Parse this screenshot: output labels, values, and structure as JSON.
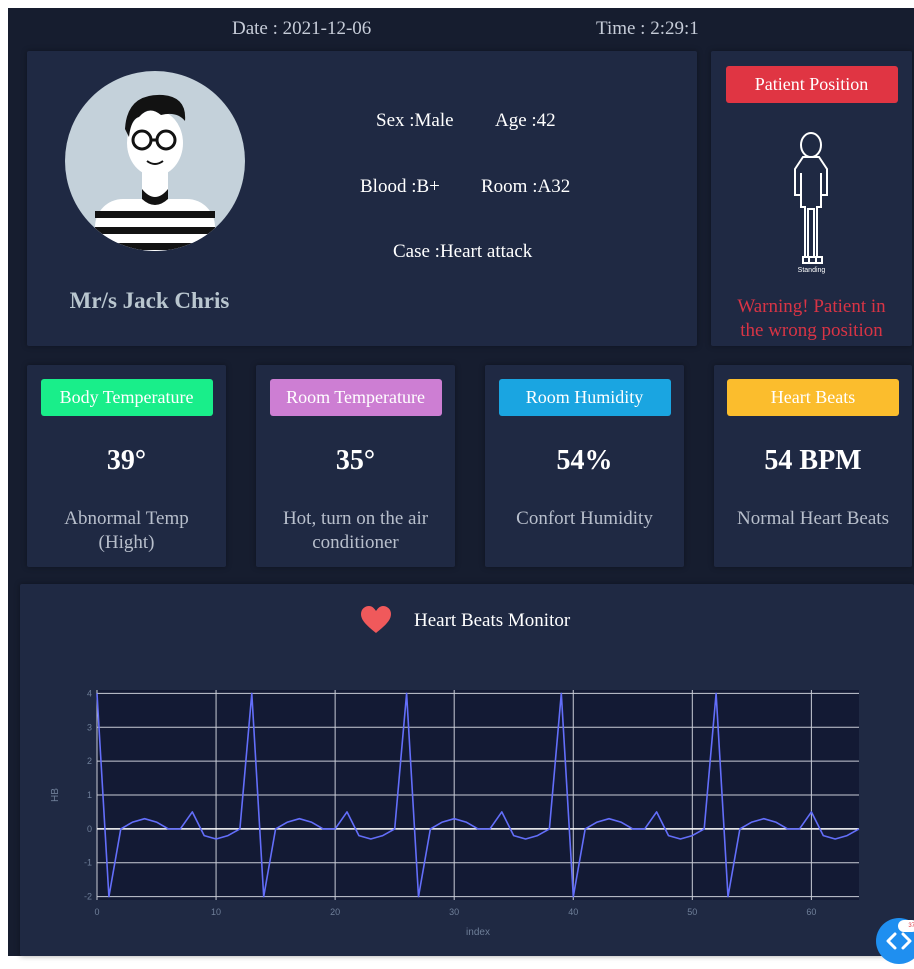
{
  "header": {
    "date": "Date : 2021-12-06",
    "time": "Time : 2:29:1"
  },
  "patient": {
    "name": "Mr/s Jack Chris",
    "sex": "Sex :Male",
    "age": "Age :42",
    "blood": "Blood :B+",
    "room": "Room :A32",
    "case": "Case :Heart attack"
  },
  "position": {
    "badge": "Patient Position",
    "figure_label": "Standing",
    "warning_line1": "Warning! Patient in",
    "warning_line2": "the wrong position",
    "badge_color": "#e03543"
  },
  "metrics": [
    {
      "badge": "Body Temperature",
      "value": "39°",
      "desc_line1": "Abnormal Temp",
      "desc_line2": "(Hight)",
      "color": "#19ee8a"
    },
    {
      "badge": "Room Temperature",
      "value": "35°",
      "desc_line1": "Hot, turn on the air",
      "desc_line2": "conditioner",
      "color": "#cd7ed3"
    },
    {
      "badge": "Room Humidity",
      "value": "54%",
      "desc_line1": "Confort Humidity",
      "desc_line2": "",
      "color": "#1aa5e1"
    },
    {
      "badge": "Heart Beats",
      "value": "54 BPM",
      "desc_line1": "Normal Heart Beats",
      "desc_line2": "",
      "color": "#fbbd2d"
    }
  ],
  "monitor": {
    "title": "Heart Beats Monitor",
    "icon": "heart-icon"
  },
  "chart_data": {
    "type": "line",
    "xlabel": "index",
    "ylabel": "HB",
    "xlim": [
      0,
      64
    ],
    "ylim": [
      -2.1,
      4.1
    ],
    "grid": true,
    "x_ticks": [
      "0",
      "10",
      "20",
      "30",
      "40",
      "50",
      "60"
    ],
    "y_ticks": [
      "-2",
      "-1",
      "0",
      "1",
      "2",
      "3",
      "4"
    ],
    "series": [
      {
        "color": "#636efa",
        "x": [
          0,
          1,
          2,
          3,
          4,
          5,
          6,
          7,
          8,
          9,
          10,
          11,
          12,
          13,
          14,
          15,
          16,
          17,
          18,
          19,
          20,
          21,
          22,
          23,
          24,
          25,
          26,
          27,
          28,
          29,
          30,
          31,
          32,
          33,
          34,
          35,
          36,
          37,
          38,
          39,
          40,
          41,
          42,
          43,
          44,
          45,
          46,
          47,
          48,
          49,
          50,
          51,
          52,
          53,
          54,
          55,
          56,
          57,
          58,
          59,
          60,
          61,
          62,
          63,
          64
        ],
        "y": [
          4,
          -2,
          0,
          0.2,
          0.3,
          0.2,
          0,
          0,
          0.5,
          -0.2,
          -0.3,
          -0.2,
          0,
          4,
          -2,
          0,
          0.2,
          0.3,
          0.2,
          0,
          0,
          0.5,
          -0.2,
          -0.3,
          -0.2,
          0,
          4,
          -2,
          0,
          0.2,
          0.3,
          0.2,
          0,
          0,
          0.5,
          -0.2,
          -0.3,
          -0.2,
          0,
          4,
          -2,
          0,
          0.2,
          0.3,
          0.2,
          0,
          0,
          0.5,
          -0.2,
          -0.3,
          -0.2,
          0,
          4,
          -2,
          0,
          0.2,
          0.3,
          0.2,
          0,
          0,
          0.5,
          -0.2,
          -0.3,
          -0.2,
          0
        ]
      }
    ]
  },
  "fab": {
    "icon": "code-toggle-icon",
    "badge_count": "37"
  }
}
